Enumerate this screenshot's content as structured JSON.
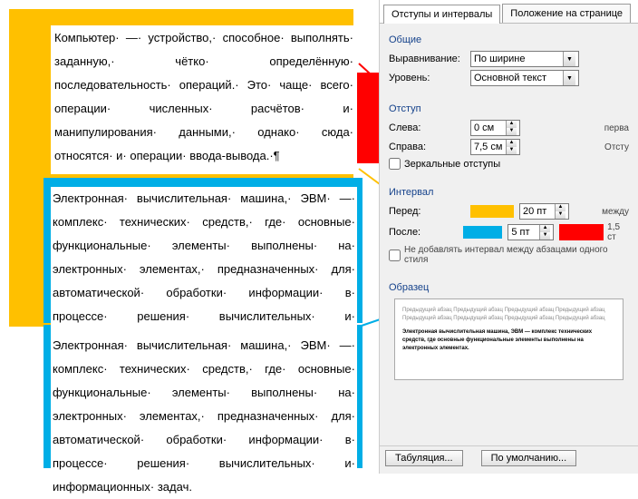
{
  "doc": {
    "para1": "Компьютер· —· устройство,· способное· выполнять· заданную,· чётко· определённую· последовательность· операций.· Это· чаще· всего· операции· численных· расчётов· и· манипулирования· данными,· однако· сюда· относятся· и· операции· ввода-вывода.·¶",
    "para2": "Электронная· вычислительная· машина,· ЭВМ· —· комплекс· технических· средств,· где· основные· функциональные· элементы· выполнены· на· электронных· элементах,· предназначенных· для· автоматической· обработки· информации· в· процессе· решения· вычислительных· и· информационных· задач.",
    "para3": "Электронная· вычислительная· машина,· ЭВМ· —· комплекс· технических· средств,· где· основные· функциональные· элементы· выполнены· на· электронных· элементах,· предназначенных· для· автоматической· обработки· информации· в· процессе· решения· вычислительных· и· информационных· задач."
  },
  "tabs": {
    "t1": "Отступы и интервалы",
    "t2": "Положение на странице"
  },
  "groups": {
    "general": "Общие",
    "indent": "Отступ",
    "interval": "Интервал",
    "sample": "Образец"
  },
  "general": {
    "align_label": "Выравнивание:",
    "align_value": "По ширине",
    "level_label": "Уровень:",
    "level_value": "Основной текст"
  },
  "indent": {
    "left_label": "Слева:",
    "left_value": "0 см",
    "right_label": "Справа:",
    "right_value": "7,5 см",
    "mirror": "Зеркальные отступы",
    "first_label": "перва",
    "rt_label": "Отсту"
  },
  "interval": {
    "before_label": "Перед:",
    "before_value": "20 пт",
    "after_label": "После:",
    "after_value": "5 пт",
    "nospace": "Не добавлять интервал между абзацами одного стиля",
    "between_label": "между",
    "ls_value": "1,5 ст"
  },
  "sample_text": {
    "grey": "Предыдущий абзац Предыдущий абзац Предыдущий абзац Предыдущий абзац Предыдущий абзац Предыдущий абзац Предыдущий абзац Предыдущий абзац",
    "bold": "Электронная вычислительная машина, ЭВМ — комплекс технических средств, где основные функциональные элементы выполнены на электронных элементах."
  },
  "buttons": {
    "tab": "Табуляция...",
    "def": "По умолчанию..."
  }
}
